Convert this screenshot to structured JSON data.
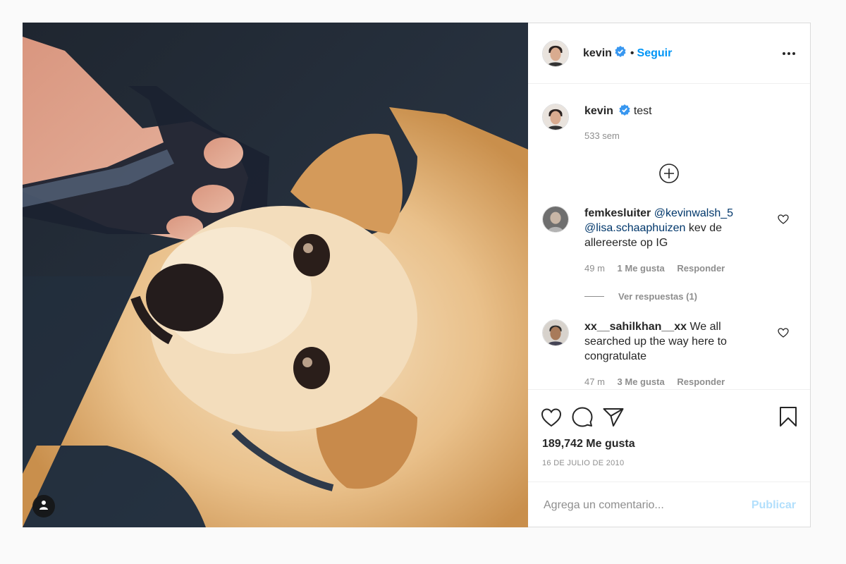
{
  "post": {
    "author": {
      "username": "kevin",
      "verified": true,
      "follow_label": "Seguir",
      "separator": "•"
    },
    "caption": {
      "username": "kevin",
      "text": "test",
      "time": "533 sem"
    },
    "comments": [
      {
        "username": "femkesluiter",
        "mentions": [
          "@kevinwalsh_5",
          "@lisa.schaaphuizen"
        ],
        "text": "kev de allereerste op IG",
        "time": "49 m",
        "likes": "1 Me gusta",
        "reply_label": "Responder",
        "view_replies": "Ver respuestas (1)"
      },
      {
        "username": "xx__sahilkhan__xx",
        "text": "We all searched up the way here to congratulate",
        "time": "47 m",
        "likes": "3 Me gusta",
        "reply_label": "Responder"
      }
    ],
    "likes_count": "189,742 Me gusta",
    "date": "16 DE JULIO DE 2010",
    "comment_input": {
      "placeholder": "Agrega un comentario...",
      "value": ""
    },
    "publish_label": "Publicar"
  },
  "icons": {
    "more": "more-options-icon",
    "load_more": "plus-circle-icon",
    "like": "heart-icon",
    "comment": "comment-bubble-icon",
    "share": "paper-plane-icon",
    "save": "bookmark-icon",
    "user_tags": "user-tag-icon",
    "verified": "verified-badge-icon"
  },
  "colors": {
    "accent": "#0095f6",
    "verified": "#3897f0",
    "muted": "#8e8e8e",
    "publish_disabled": "#b2dffc",
    "mention": "#00376b"
  }
}
